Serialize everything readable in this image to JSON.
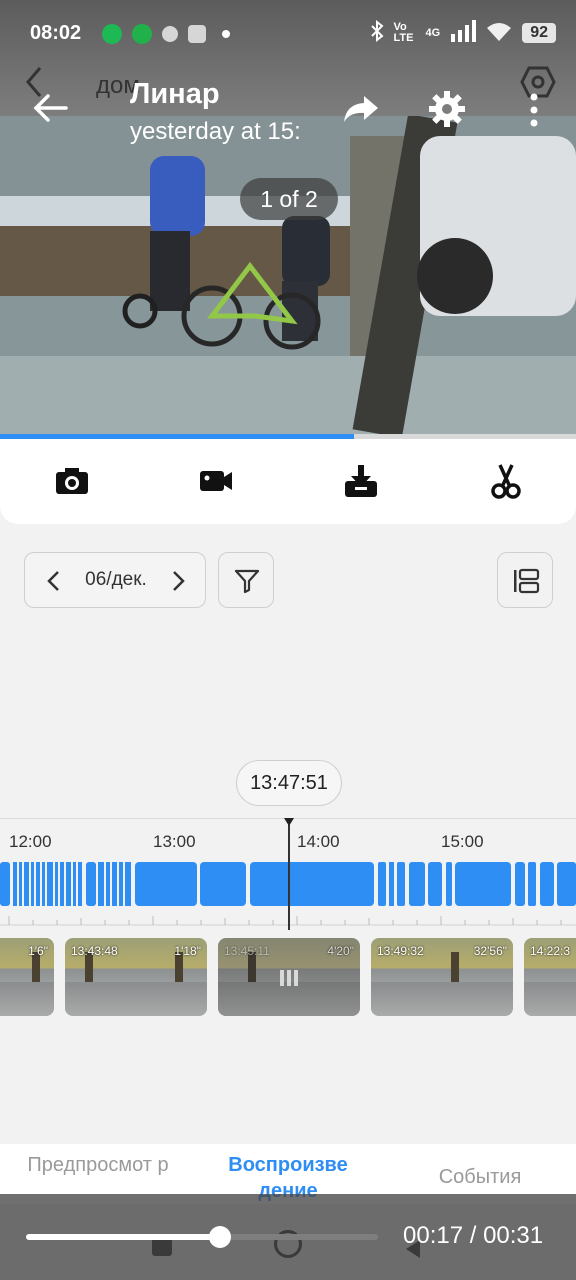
{
  "status_bar": {
    "time": "08:02",
    "battery": "92",
    "network": "4G",
    "volte": "Vo LTE"
  },
  "underlying_app": {
    "title": "дом"
  },
  "viewer": {
    "sender_name": "Линар",
    "subtitle": "yesterday at 15:",
    "counter": "1 of 2",
    "playback_progress": 0.615
  },
  "actions": [
    "camera-icon",
    "video-record-icon",
    "download-icon",
    "scissors-icon"
  ],
  "date_nav": {
    "label": "06/дек."
  },
  "timeline": {
    "current_time": "13:47:51",
    "hour_labels": [
      "12:00",
      "13:00",
      "14:00",
      "15:00"
    ],
    "accent_color": "#2f8ef3"
  },
  "clips": [
    {
      "start": "",
      "duration": "1'6\""
    },
    {
      "start": "13:43:48",
      "duration": "1'18\""
    },
    {
      "start": "13:45:11",
      "duration": "4'20\""
    },
    {
      "start": "13:49:32",
      "duration": "32'56\""
    },
    {
      "start": "14:22:3",
      "duration": ""
    }
  ],
  "tabs": {
    "preview": "Предпросмот р",
    "playback": "Воспроизве дение",
    "events": "События",
    "active": "playback"
  },
  "player": {
    "elapsed_fraction": 0.55,
    "time_readout": "00:17 / 00:31"
  }
}
